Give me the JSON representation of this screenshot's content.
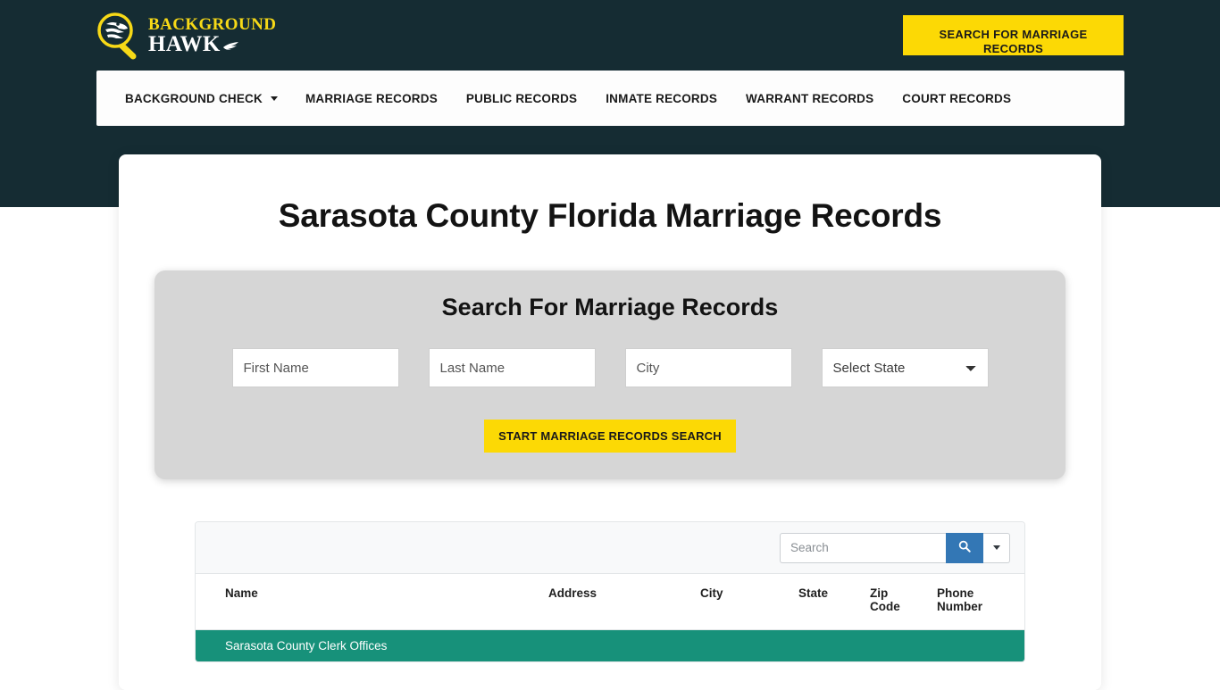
{
  "theme": {
    "header_bg": "#152c33",
    "accent_yellow": "#fcd905",
    "group_green": "#17917a",
    "search_blue": "#3377b5"
  },
  "header": {
    "logo": {
      "line1": "BACKGROUND",
      "line2": "HAWK",
      "icon": "magnifier-hawk-logo"
    },
    "cta_button": "SEARCH FOR MARRIAGE RECORDS"
  },
  "nav": {
    "items": [
      {
        "label": "BACKGROUND CHECK",
        "has_dropdown": true
      },
      {
        "label": "MARRIAGE RECORDS",
        "has_dropdown": false
      },
      {
        "label": "PUBLIC RECORDS",
        "has_dropdown": false
      },
      {
        "label": "INMATE RECORDS",
        "has_dropdown": false
      },
      {
        "label": "WARRANT RECORDS",
        "has_dropdown": false
      },
      {
        "label": "COURT RECORDS",
        "has_dropdown": false
      }
    ]
  },
  "main": {
    "page_title": "Sarasota County Florida Marriage Records",
    "search_panel": {
      "title": "Search For Marriage Records",
      "fields": {
        "first_name_placeholder": "First Name",
        "last_name_placeholder": "Last Name",
        "city_placeholder": "City",
        "state_selected": "Select State"
      },
      "submit_label": "START MARRIAGE RECORDS SEARCH"
    },
    "table": {
      "search_placeholder": "Search",
      "columns": [
        "Name",
        "Address",
        "City",
        "State",
        "Zip Code",
        "Phone Number"
      ],
      "group_row_label": "Sarasota County Clerk Offices"
    }
  }
}
